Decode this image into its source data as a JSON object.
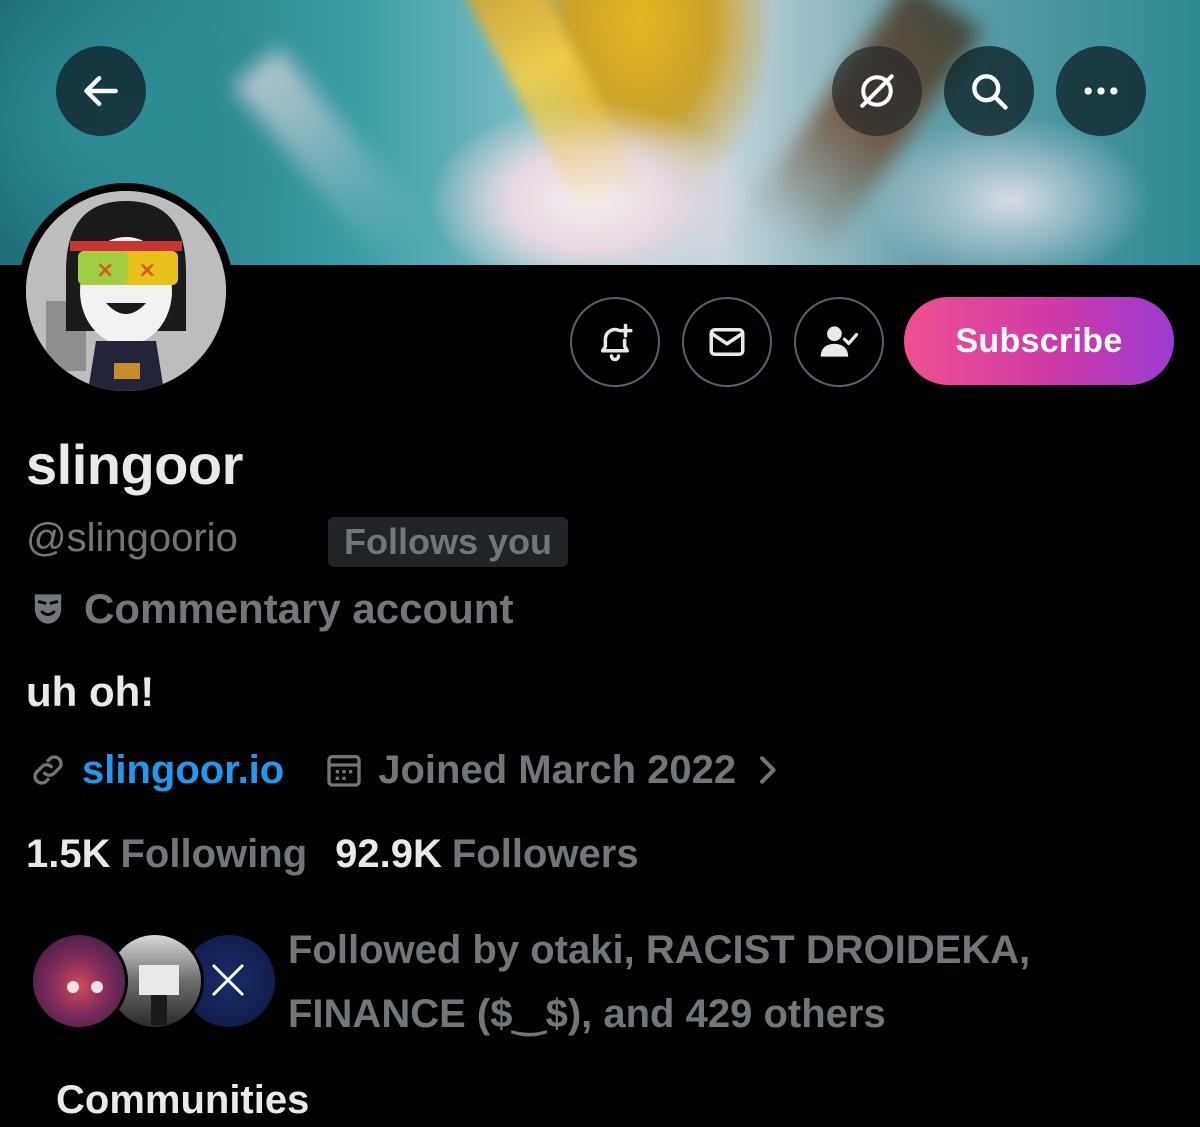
{
  "header": {
    "back_label": "Back",
    "icons": [
      "arrow-left-icon",
      "grok-icon",
      "search-icon",
      "more-icon"
    ]
  },
  "profile": {
    "display_name": "slingoor",
    "handle": "@slingoorio",
    "follows_you": "Follows you",
    "label": "Commentary account",
    "bio": "uh oh!",
    "website": "slingoor.io",
    "joined": "Joined March 2022",
    "following_count": "1.5K",
    "following_label": "Following",
    "followers_count": "92.9K",
    "followers_label": "Followers",
    "followed_by_text": "Followed by otaki, RACIST DROIDEKA, FINANCE ($‿$), and 429 others"
  },
  "actions": {
    "subscribe_label": "Subscribe",
    "icons": [
      "notification-bell-plus-icon",
      "mail-icon",
      "following-check-icon"
    ]
  },
  "sections": {
    "communities_title": "Communities"
  },
  "colors": {
    "background": "#000000",
    "primary_text": "#e7e9ea",
    "secondary_text": "#71767b",
    "link": "#1d9bf0",
    "subscribe_gradient_start": "#f0508f",
    "subscribe_gradient_end": "#9b3bd2"
  }
}
